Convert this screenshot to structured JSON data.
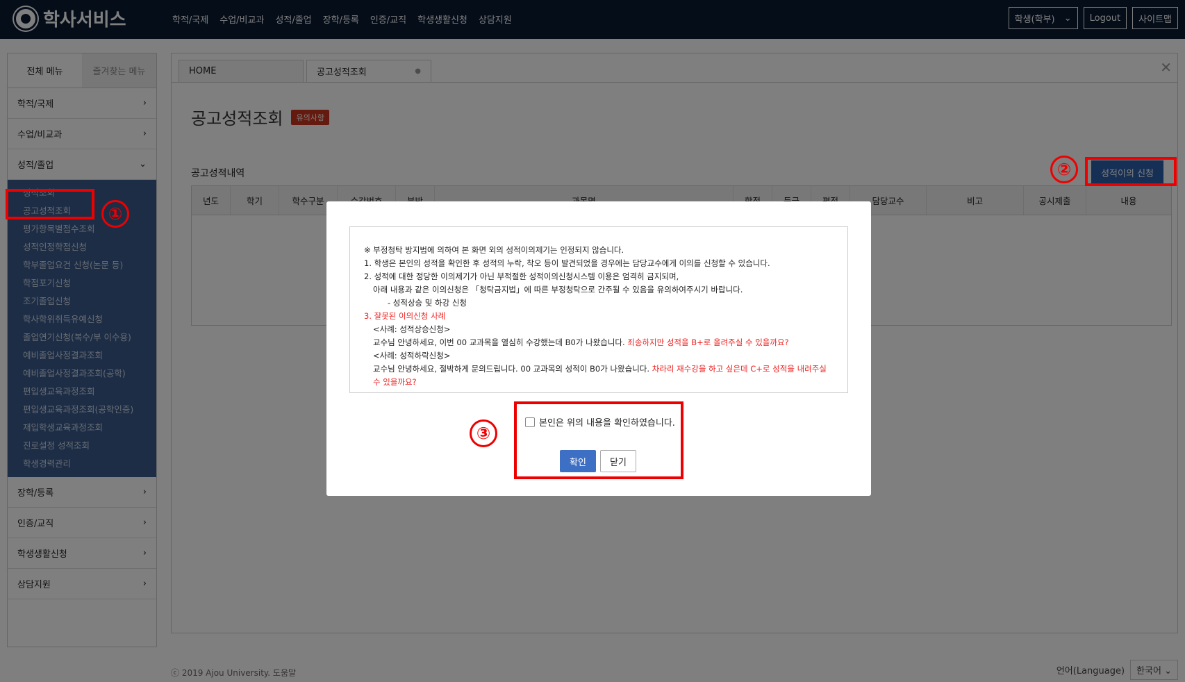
{
  "header": {
    "logo_text": "학사서비스",
    "nav": [
      "학적/국제",
      "수업/비교과",
      "성적/졸업",
      "장학/등록",
      "인증/교직",
      "학생생활신청",
      "상담지원"
    ],
    "role_select": "학생(학부)",
    "logout_label": "Logout",
    "sitemap_label": "사이트맵"
  },
  "sidebar": {
    "tab_all": "전체 메뉴",
    "tab_fav": "즐겨찾는 메뉴",
    "menu": [
      "학적/국제",
      "수업/비교과",
      "성적/졸업",
      "장학/등록",
      "인증/교직",
      "학생생활신청",
      "상담지원"
    ],
    "grade_submenu": [
      "성적조회",
      "공고성적조회",
      "평가항목별점수조회",
      "성적인정학점신청",
      "학부졸업요건 신청(논문 등)",
      "학점포기신청",
      "조기졸업신청",
      "학사학위취득유예신청",
      "졸업연기신청(복수/부 이수용)",
      "예비졸업사정결과조회",
      "예비졸업사정결과조회(공학)",
      "편입생교육과정조회",
      "편입생교육과정조회(공학인증)",
      "재입학생교육과정조회",
      "진로설정 성적조회",
      "학생경력관리"
    ]
  },
  "tabs": {
    "home": "HOME",
    "active": "공고성적조회"
  },
  "page": {
    "title": "공고성적조회",
    "notice_badge": "유의사항",
    "section_title": "공고성적내역",
    "appeal_button": "성적이의 신청",
    "columns": [
      "년도",
      "학기",
      "학수구분",
      "수강번호",
      "분반",
      "과목명",
      "학점",
      "등급",
      "평점",
      "담당교수",
      "비고",
      "공시제출",
      "내용"
    ]
  },
  "modal": {
    "line1": "※ 부정청탁 방지법에 의하여 본 화면 외의 성적이의제기는 인정되지 않습니다.",
    "line2": "1. 학생은 본인의 성적을 확인한 후 성적의 누락, 착오 등이 발견되었을 경우에는 담당교수에게 이의를 신청할 수 있습니다.",
    "line3": "2. 성적에 대한 정당한 이의제기가 아닌 부적절한 성적이의신청시스템 이용은 엄격히 금지되며,",
    "line4": "아래 내용과 같은 이의신청은 「청탁금지법」에 따른 부정청탁으로 간주될 수 있음을 유의하여주시기 바랍니다.",
    "line5": "- 성적상승 및 하강 신청",
    "line6": "3. 잘못된 이의신청 사례",
    "line7": "<사례: 성적상승신청>",
    "line8a": "교수님 안녕하세요, 이번 00 교과목을 열심히 수강했는데 B0가 나왔습니다.",
    "line8b": "죄송하지만 성적을 B+로 올려주실 수 있을까요?",
    "line9": "<사례: 성적하락신청>",
    "line10a": "교수님 안녕하세요, 절박하게 문의드립니다. 00 교과목의 성적이 B0가 나왔습니다.",
    "line10b": "차라리 재수강을 하고 싶은데 C+로 성적을 내려주실 수 있을까요?",
    "checkbox_label": "본인은 위의 내용을 확인하였습니다.",
    "ok_label": "확인",
    "close_label": "닫기"
  },
  "annotations": [
    "①",
    "②",
    "③"
  ],
  "footer": {
    "copyright": "ⓒ 2019 Ajou University. 도움말",
    "language_label": "언어(Language)",
    "language_value": "한국어"
  },
  "colors": {
    "header_bg": "#0b1a33",
    "submenu_bg": "#3a5a8c",
    "primary_button": "#3d6fc4",
    "badge_red": "#c8351e",
    "annotation_red": "#e00000"
  }
}
